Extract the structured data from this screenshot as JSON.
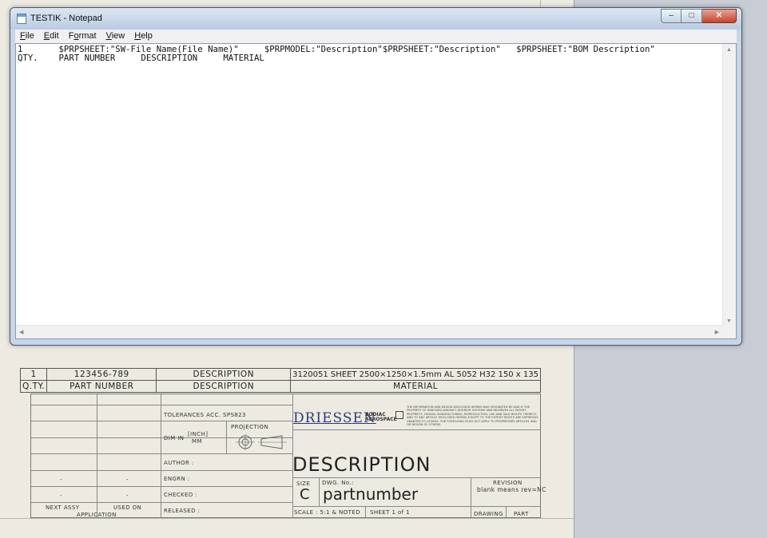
{
  "window": {
    "title": "TESTIK - Notepad",
    "minimize": "–",
    "maximize": "□",
    "close": "✕"
  },
  "menu": [
    {
      "key": "F",
      "rest": "ile"
    },
    {
      "key": "E",
      "rest": "dit"
    },
    {
      "pre": "F",
      "key": "o",
      "rest": "rmat"
    },
    {
      "key": "V",
      "rest": "iew"
    },
    {
      "key": "H",
      "rest": "elp"
    }
  ],
  "editor": {
    "lines": [
      "1       $PRPSHEET:\"SW-File Name(File Name)\"     $PRPMODEL:\"Description\"$PRPSHEET:\"Description\"   $PRPSHEET:\"BOM Description\"",
      "QTY.    PART NUMBER     DESCRIPTION     MATERIAL"
    ]
  },
  "bom": {
    "row1": [
      "1",
      "123456-789",
      "DESCRIPTION",
      "3120051 SHEET 2500×1250×1.5mm AL 5052 H32 150 x 135"
    ],
    "header": [
      "Q.TY.",
      "PART NUMBER",
      "DESCRIPTION",
      "MATERIAL"
    ]
  },
  "title_block": {
    "tolerances": "TOLERANCES ACC. SPS823",
    "projection": "PROJECTION",
    "dim_in": "DIM IN",
    "inch": "INCH]",
    "inch_bracket": "[",
    "mm": "MM",
    "author": "AUTHOR   :",
    "engrn": "ENGRN    :",
    "checked": "CHECKED  :",
    "released": "RELEASED :",
    "dash1": "-",
    "dash2": "-",
    "dash3": "-",
    "dash4": "-",
    "next_assy": "NEXT ASSY",
    "used_on": "USED ON",
    "application": "APPLICATION",
    "logo": "DRIESSEN",
    "logo2_a": "ZODIAC",
    "logo2_b": "AEROSPACE",
    "fine_print": "THE INFORMATION AND DESIGN DISCLOSED HEREIN WAS ORIGINATED BY AND IS THE PROPERTY OF DRIESSEN AIRCRAFT INTERIOR SYSTEMS AND RESERVES ALL PATENT, PROPRIETY, DESIGN, MANUFACTURING, REPRODUCTION, USE AND SALE RIGHTS THERETO AND TO ANY ARTICLE DISCLOSED HEREIN, EXCEPT TO THE EXTENT RIGHTS ARE EXPRESSLY GRANTED TO OTHERS. THE FOREGOING DOES NOT APPLY TO PROPRIETARY ARTICLES AND OR DESIGN OF OTHERS.",
    "description": "DESCRIPTION",
    "size_label": "SIZE",
    "size": "C",
    "dwg_no": "DWG. No.:",
    "part_number": "partnumber",
    "revision": "REVISION",
    "revision_note": "blank means rev=NC",
    "scale": "SCALE : 5:1 & NOTED",
    "sheet": "SHEET 1 of 1",
    "drawing": "DRAWING",
    "part": "PART"
  }
}
